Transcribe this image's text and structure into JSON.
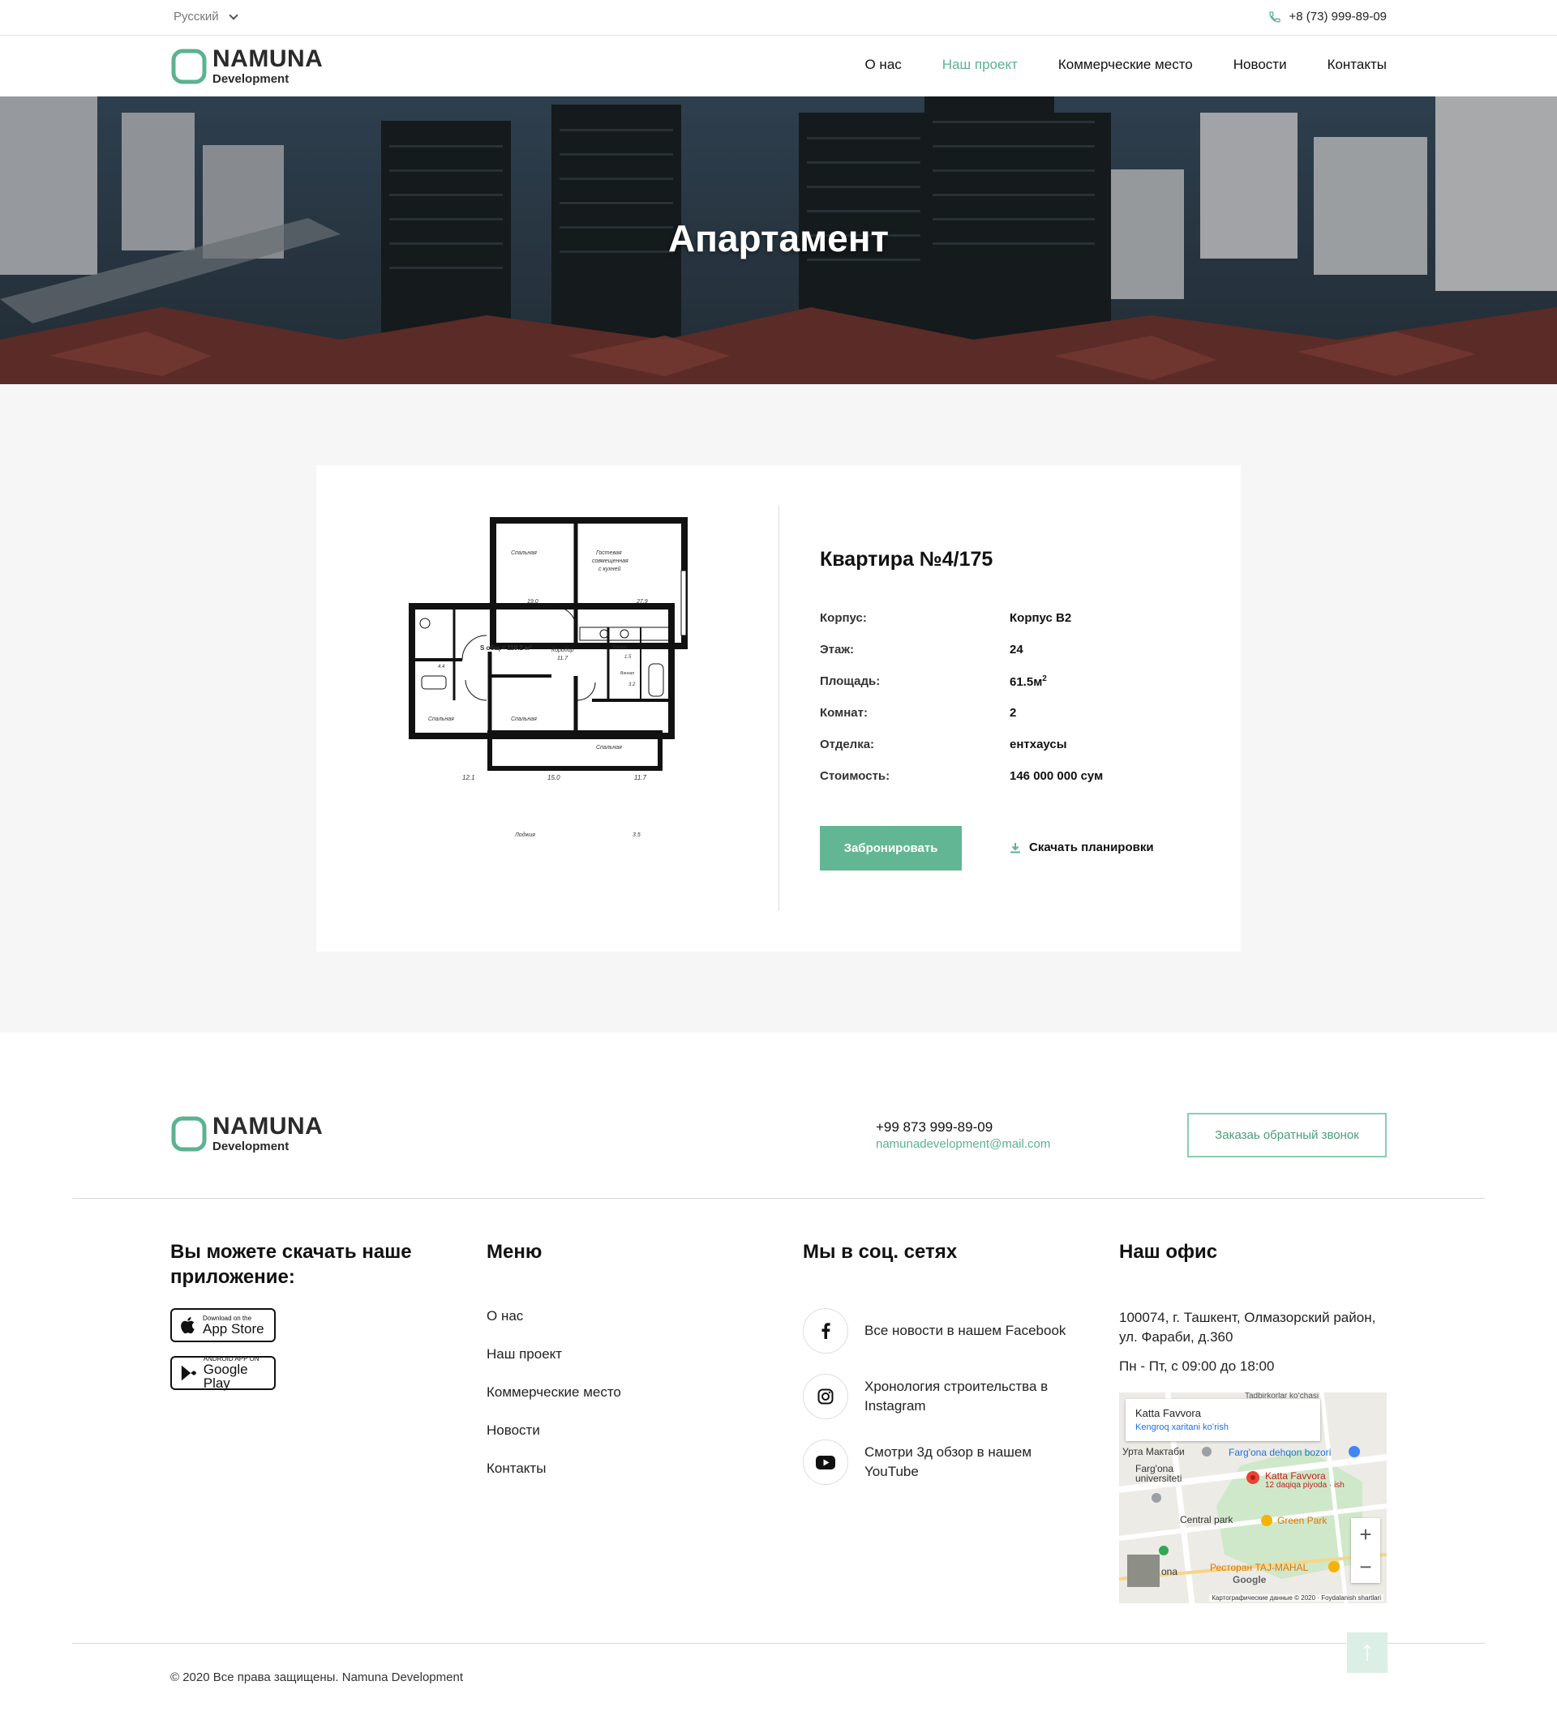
{
  "topbar": {
    "language": "Русский",
    "phone": "+8 (73) 999-89-09"
  },
  "brand": {
    "name": "NAMUNA",
    "sub": "Development",
    "accent": "#5ab38f"
  },
  "nav": {
    "items": [
      {
        "label": "О нас"
      },
      {
        "label": "Наш проект",
        "active": true
      },
      {
        "label": "Коммерческие место"
      },
      {
        "label": "Новости"
      },
      {
        "label": "Контакты"
      }
    ]
  },
  "hero": {
    "title": "Апартамент"
  },
  "apartment": {
    "title": "Квартира №4/175",
    "specs": [
      {
        "label": "Корпус:",
        "value": "Корпус В2"
      },
      {
        "label": "Этаж:",
        "value": "24"
      },
      {
        "label": "Площадь:",
        "value": "61.5м",
        "sup": "2"
      },
      {
        "label": "Комнат:",
        "value": "2"
      },
      {
        "label": "Отделка:",
        "value": "ентхаусы"
      },
      {
        "label": "Стоимость:",
        "value": "146 000 000 сум"
      }
    ],
    "book_label": "Забронировать",
    "download_label": "Скачать планировки",
    "plan": {
      "total": "S общ.= 110.2 м²",
      "rooms": [
        {
          "name": "Спальная",
          "area": "19.0"
        },
        {
          "name": "Гостевая совмещенная с кухней",
          "area": "27.9"
        },
        {
          "name": "Коридор",
          "area": "11.7"
        },
        {
          "name": "Туалет",
          "area": "1.5"
        },
        {
          "name": "Ванная",
          "area": "3.2"
        },
        {
          "name": "",
          "area": "4.4"
        },
        {
          "name": "Спальная",
          "area": "12.1"
        },
        {
          "name": "Спальная",
          "area": "15.0"
        },
        {
          "name": "Спальная",
          "area": "11.7"
        },
        {
          "name": "Лоджия",
          "area": "3.5"
        }
      ]
    }
  },
  "footer": {
    "phone": "+99 873 999-89-09",
    "email": "namunadevelopment@mail.com",
    "callback_label": "Заказаь обратный звонок",
    "app_title": "Вы можете скачать наше приложение:",
    "appstore": {
      "small": "Download on the",
      "big": "App Store"
    },
    "googleplay": {
      "small": "ANDROID APP ON",
      "big": "Google Play"
    },
    "menu_title": "Меню",
    "menu": [
      "О нас",
      "Наш проект",
      "Коммерческие место",
      "Новости",
      "Контакты"
    ],
    "social_title": "Мы в соц. сетях",
    "social": [
      {
        "icon": "facebook-icon",
        "text": "Все новости в нашем Facebook"
      },
      {
        "icon": "instagram-icon",
        "text": "Хронология строительства в Instagram"
      },
      {
        "icon": "youtube-icon",
        "text": "Смотри 3д обзор в нашем YouTube"
      }
    ],
    "office_title": "Наш офис",
    "address": "100074, г. Ташкент, Олмазорский район, ул. Фараби, д.360",
    "hours": "Пн - Пт, с 09:00 до 18:00",
    "map": {
      "place": "Katta Favvora",
      "link": "Kengroq xaritani koʻrish",
      "labels": [
        "Tadbirkorlar koʻchasi",
        "Урта Мактаби",
        "Farg'ona dehqon bozori",
        "Farg'ona universiteti",
        "Katta Favvora",
        "12 daqiqa piyoda · ish",
        "Central park",
        "Green Park",
        "Ресторан TAJ-MAHAL",
        "Google",
        "Картографические данные © 2020",
        "Foydalanish shartlari",
        "ona"
      ]
    },
    "copyright": "© 2020 Все права защищены. Namuna Development"
  }
}
